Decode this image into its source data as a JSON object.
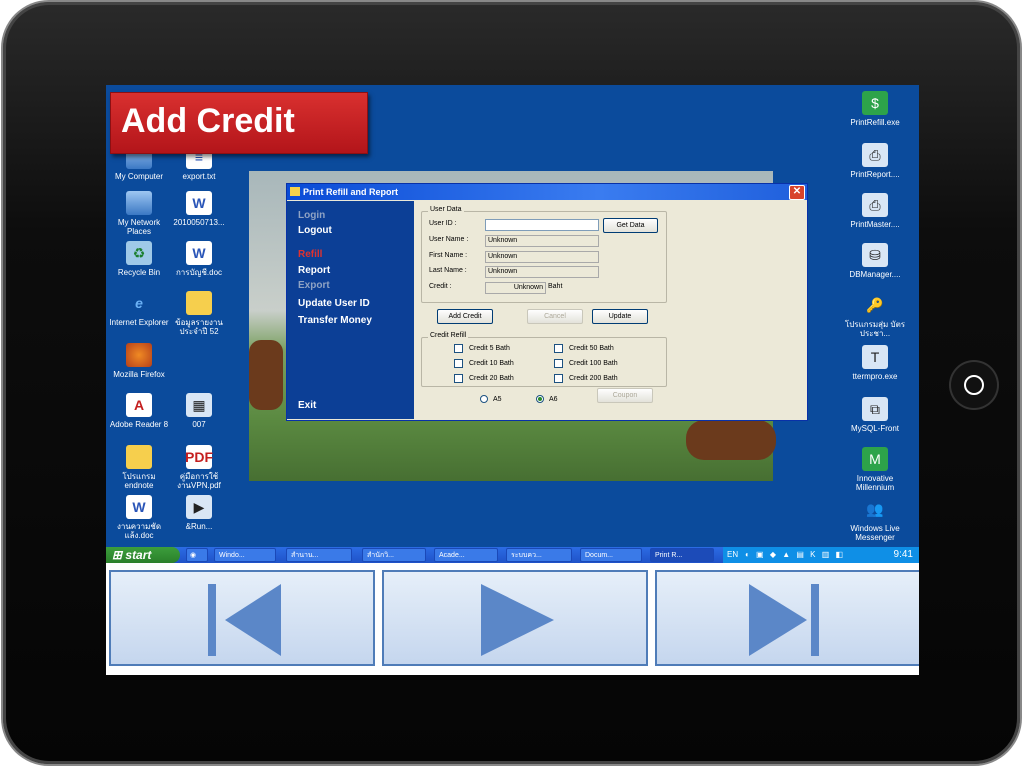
{
  "banner": {
    "title": "Add Credit"
  },
  "desktop": {
    "left_icons": [
      {
        "label": "My Computer",
        "icon": "computer-icon"
      },
      {
        "label": "export.txt",
        "icon": "document-icon"
      },
      {
        "label": "My Network Places",
        "icon": "network-icon"
      },
      {
        "label": "2010050713...",
        "icon": "document-icon"
      },
      {
        "label": "Recycle Bin",
        "icon": "recycle-bin-icon"
      },
      {
        "label": "การบัญชี.doc",
        "icon": "document-icon"
      },
      {
        "label": "Internet Explorer",
        "icon": "ie-icon"
      },
      {
        "label": "ข้อมูลรายงาน ประจำปี 52",
        "icon": "folder-icon"
      },
      {
        "label": "Mozilla Firefox",
        "icon": "firefox-icon"
      },
      {
        "label": "Adobe Reader 8",
        "icon": "pdf-icon"
      },
      {
        "label": "007",
        "icon": "app-icon"
      },
      {
        "label": "โปรแกรม endnote",
        "icon": "folder-icon"
      },
      {
        "label": "คู่มือการใช้ งานVPN.pdf",
        "icon": "pdf-icon"
      },
      {
        "label": "งานความชัด แล้ง.doc",
        "icon": "document-icon"
      },
      {
        "label": "&Run...",
        "icon": "run-icon"
      }
    ],
    "right_icons": [
      {
        "label": "PrintRefill.exe",
        "icon": "app-icon"
      },
      {
        "label": "PrintReport....",
        "icon": "printer-icon"
      },
      {
        "label": "PrintMaster....",
        "icon": "printer-icon"
      },
      {
        "label": "DBManager....",
        "icon": "database-icon"
      },
      {
        "label": "โปรแกรมสุ่ม บัตรประชา...",
        "icon": "key-icon"
      },
      {
        "label": "ttermpro.exe",
        "icon": "terminal-icon"
      },
      {
        "label": "MySQL-Front",
        "icon": "app-icon"
      },
      {
        "label": "Innovative Millennium",
        "icon": "app-icon"
      },
      {
        "label": "Windows Live Messenger",
        "icon": "messenger-icon"
      }
    ]
  },
  "dialog": {
    "title": "Print Refill and Report",
    "menu": {
      "login": "Login",
      "logout": "Logout",
      "refill": "Refill",
      "report": "Report",
      "export": "Export",
      "update_user_id": "Update User ID",
      "transfer_money": "Transfer Money",
      "exit": "Exit"
    },
    "user_data": {
      "legend": "User Data",
      "user_id_label": "User ID :",
      "user_id_value": "",
      "get_data": "Get Data",
      "user_name_label": "User Name :",
      "user_name_value": "Unknown",
      "first_name_label": "First Name :",
      "first_name_value": "Unknown",
      "last_name_label": "Last Name :",
      "last_name_value": "Unknown",
      "credit_label": "Credit :",
      "credit_value": "Unknown",
      "credit_unit": "Baht",
      "add_credit": "Add Credit",
      "cancel": "Cancel",
      "update": "Update"
    },
    "credit_refill": {
      "legend": "Credit Refill",
      "options": [
        "Credit 5 Bath",
        "Credit 50 Bath",
        "Credit 10 Bath",
        "Credit 100 Bath",
        "Credit 20 Bath",
        "Credit 200 Bath"
      ]
    },
    "paper": {
      "a5": "A5",
      "a6": "A6",
      "selected": "A6"
    },
    "coupon": "Coupon"
  },
  "taskbar": {
    "start": "start",
    "tasks": [
      "Windo...",
      "สำนาน...",
      "สำนักวิ...",
      "Acade...",
      "ระบบคว...",
      "Docum...",
      "Print R..."
    ],
    "lang": "EN",
    "clock": "9:41"
  },
  "nav": {
    "colors": {
      "button_border": "#4f7cb8",
      "arrow": "#5b87c8"
    }
  }
}
